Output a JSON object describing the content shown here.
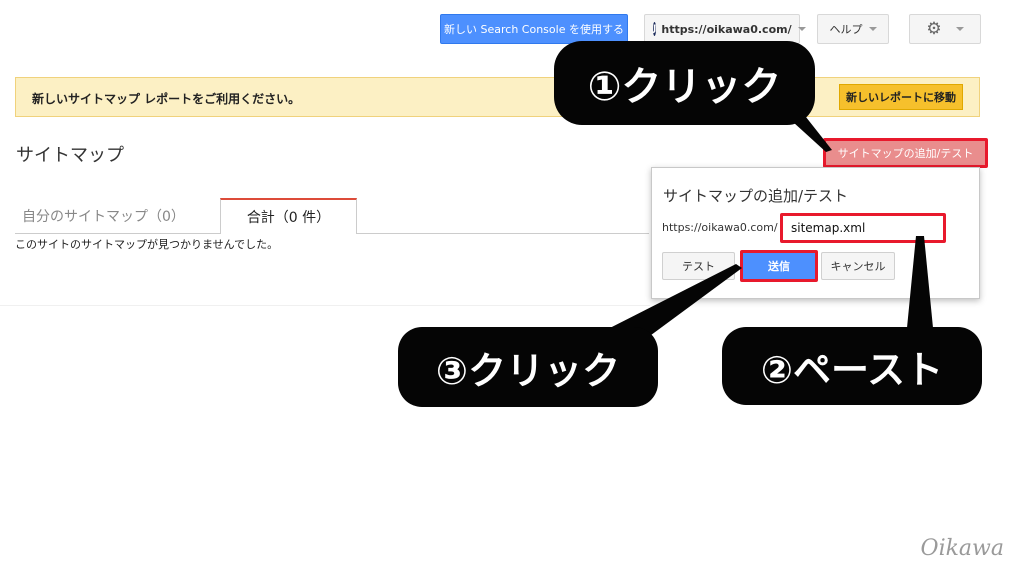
{
  "header": {
    "new_search_console_label": "新しい Search Console を使用する",
    "site_logo_letter": "J",
    "site_url": "https://oikawa0.com/",
    "help_label": "ヘルプ",
    "gear_icon": "gear-icon"
  },
  "banner": {
    "text": "新しいサイトマップ レポートをご利用ください。",
    "button_label": "新しいレポートに移動"
  },
  "page": {
    "title": "サイトマップ",
    "add_test_button_label": "サイトマップの追加/テスト",
    "tabs": [
      {
        "label": "自分のサイトマップ（0）"
      },
      {
        "label": "合計（0 件）"
      }
    ],
    "empty_message": "このサイトのサイトマップが見つかりませんでした。"
  },
  "dialog": {
    "title": "サイトマップの追加/テスト",
    "url_prefix": "https://oikawa0.com/",
    "input_value": "sitemap.xml",
    "test_label": "テスト",
    "submit_label": "送信",
    "cancel_label": "キャンセル"
  },
  "callouts": {
    "step1": "①クリック",
    "step2": "②ペースト",
    "step3": "③クリック"
  },
  "colors": {
    "primary_blue": "#4d90fe",
    "highlight_red": "#e8192c",
    "banner_bg": "#fcf0c4",
    "banner_button": "#f6c02c",
    "callout_bg": "#050505"
  },
  "signature": "Oikawa"
}
